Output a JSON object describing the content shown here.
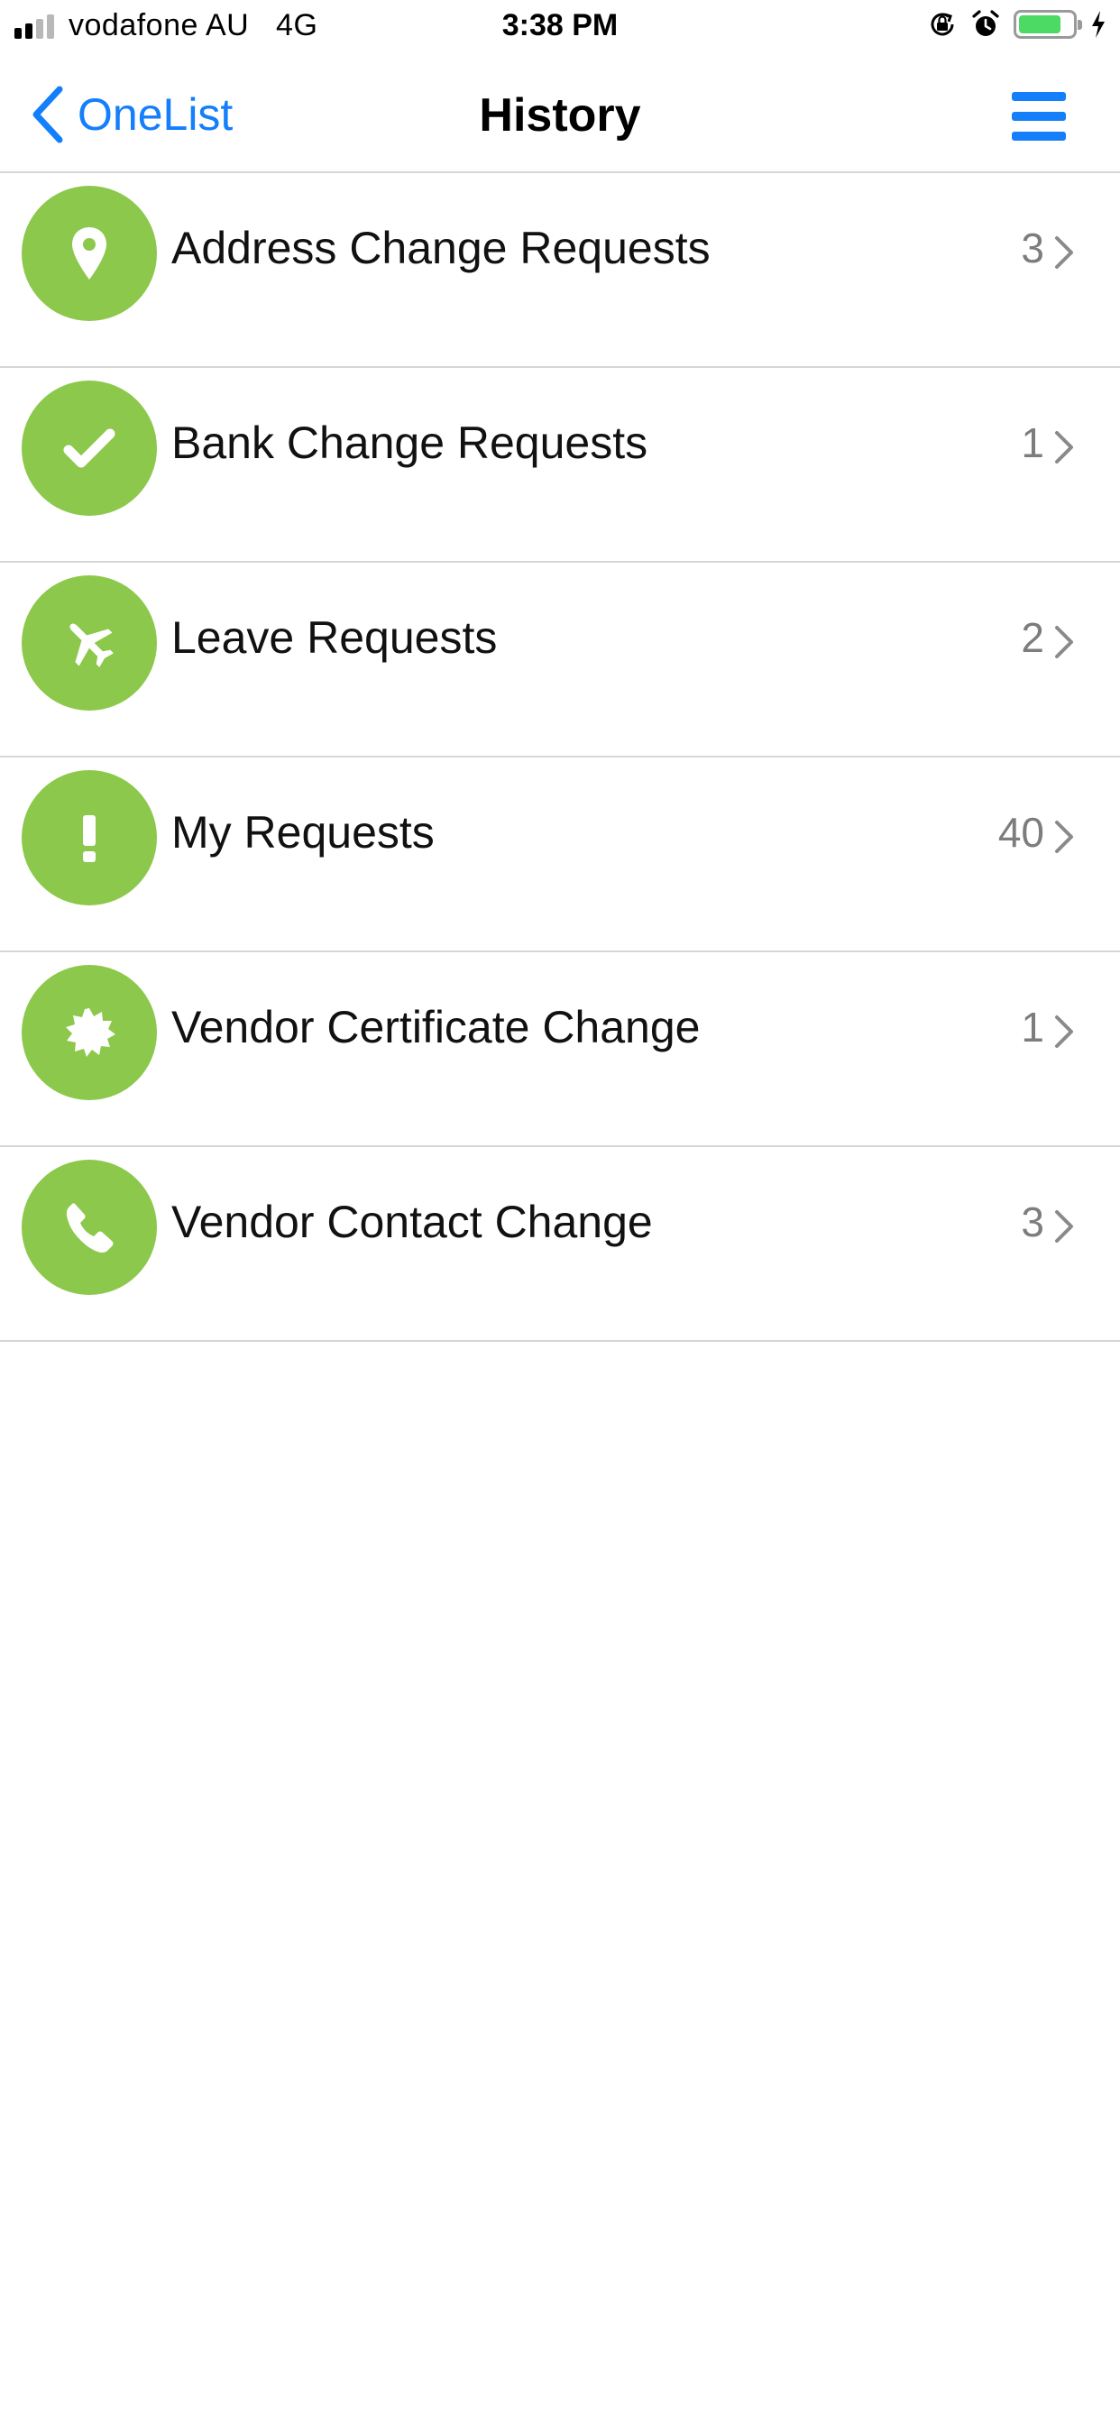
{
  "status_bar": {
    "carrier": "vodafone AU",
    "network": "4G",
    "time": "3:38 PM",
    "battery_color": "#4cd964",
    "battery_level": 0.8,
    "signal_bars_active": 2,
    "signal_bars_total": 4
  },
  "nav": {
    "back_label": "OneList",
    "title": "History",
    "accent_color": "#147efb"
  },
  "icon_color": "#8cc84b",
  "rows": [
    {
      "label": "Address Change Requests",
      "count": "3",
      "icon": "map-pin-icon"
    },
    {
      "label": "Bank Change Requests",
      "count": "1",
      "icon": "checkmark-icon"
    },
    {
      "label": "Leave Requests",
      "count": "2",
      "icon": "airplane-icon"
    },
    {
      "label": "My Requests",
      "count": "40",
      "icon": "exclamation-icon"
    },
    {
      "label": "Vendor Certificate Change",
      "count": "1",
      "icon": "certificate-badge-icon"
    },
    {
      "label": "Vendor Contact Change",
      "count": "3",
      "icon": "phone-icon"
    }
  ]
}
